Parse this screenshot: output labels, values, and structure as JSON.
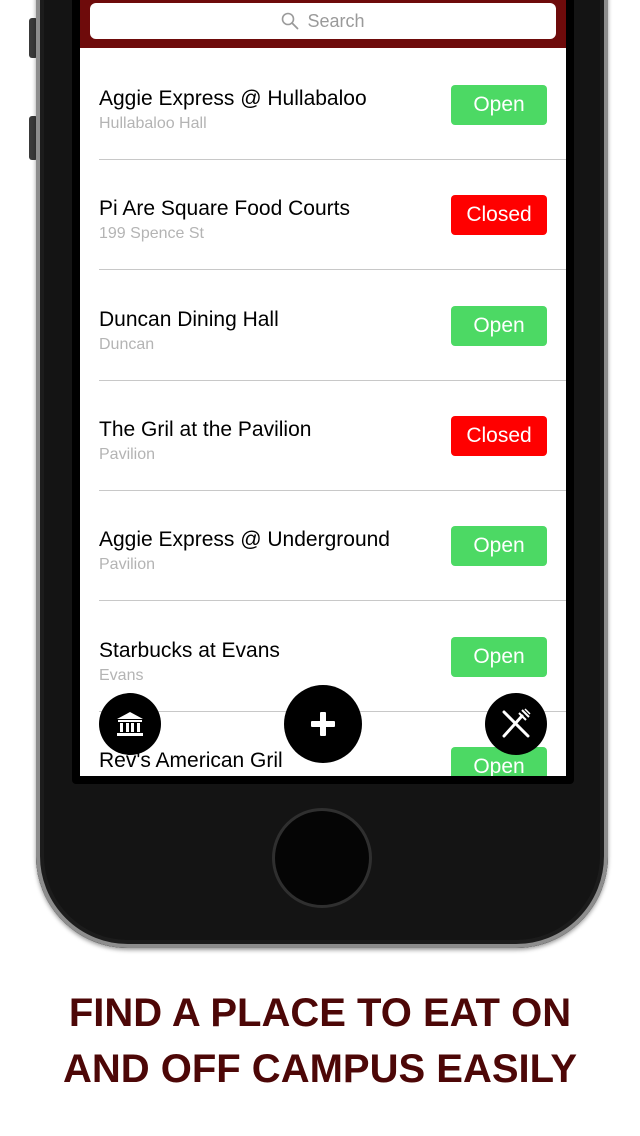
{
  "search": {
    "placeholder": "Search"
  },
  "restaurants": [
    {
      "name": "Aggie Express @ Hullabaloo",
      "location": "Hullabaloo Hall",
      "status": "Open"
    },
    {
      "name": "Pi Are Square Food Courts",
      "location": "199 Spence St",
      "status": "Closed"
    },
    {
      "name": "Duncan Dining Hall",
      "location": "Duncan",
      "status": "Open"
    },
    {
      "name": "The Gril at the Pavilion",
      "location": "Pavilion",
      "status": "Closed"
    },
    {
      "name": "Aggie Express @ Underground",
      "location": "Pavilion",
      "status": "Open"
    },
    {
      "name": "Starbucks at Evans",
      "location": "Evans",
      "status": "Open"
    },
    {
      "name": "Rev's American Gril",
      "location": "",
      "status": "Open"
    }
  ],
  "status_colors": {
    "Open": "#4cd964",
    "Closed": "#ff0000"
  },
  "header_color": "#6e0b0b",
  "tagline": {
    "line1": "FIND A PLACE TO EAT ON",
    "line2": "AND OFF CAMPUS EASILY"
  },
  "icons": {
    "left_fab": "building-icon",
    "center_fab": "plus-icon",
    "right_fab": "fork-knife-icon",
    "search": "search-icon"
  }
}
